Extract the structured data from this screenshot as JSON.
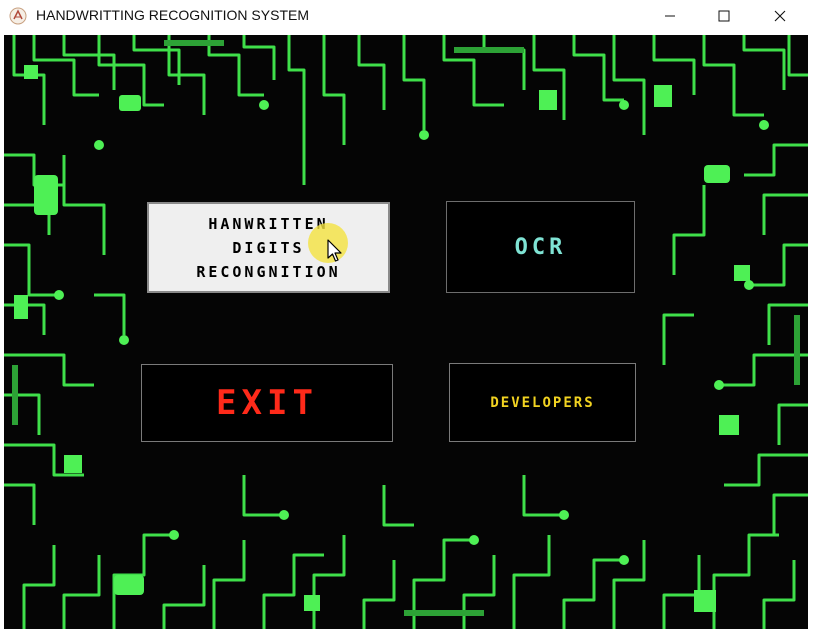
{
  "window": {
    "title": "HANDWRITTING RECOGNITION SYSTEM",
    "icon": "app-logo-icon",
    "controls": [
      "minimize-icon",
      "maximize-icon",
      "close-icon"
    ]
  },
  "background": {
    "description_icon": "circuit-board-pattern",
    "trace_color": "#3fe04a"
  },
  "buttons": {
    "handwritten": {
      "label": "HANWRITTEN\nDIGITS\nRECONGNITION",
      "state": "hover"
    },
    "ocr": {
      "label": "OCR",
      "color": "#7fe3d4"
    },
    "exit": {
      "label": "EXIT",
      "color": "#ff2a1a"
    },
    "developers": {
      "label": "DEVELOPERS",
      "color": "#f2d321"
    }
  },
  "pointer": {
    "icon": "mouse-pointer-icon",
    "highlight_color": "#f4e240"
  }
}
